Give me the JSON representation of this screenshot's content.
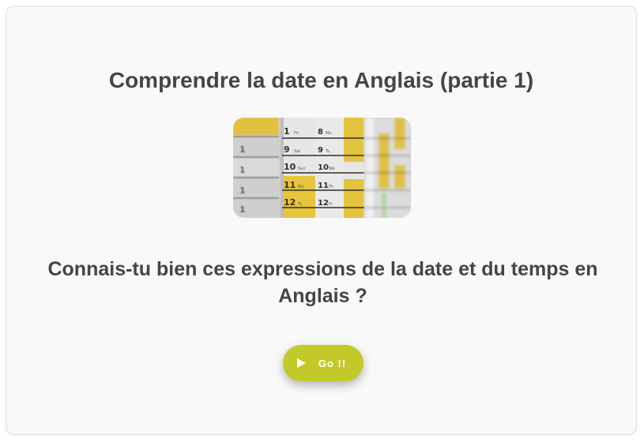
{
  "card": {
    "title": "Comprendre la date en Anglais (partie 1)",
    "image": {
      "icon": "calendar-photo",
      "colors": {
        "yellow": "#e7c43a",
        "paper": "#e2e2e2",
        "ink": "#2f2f2f"
      },
      "visible_numbers": [
        "8",
        "9",
        "10",
        "11",
        "12"
      ]
    },
    "question": "Connais-tu bien ces expressions de la date et du temps en Anglais ?",
    "button": {
      "label": "Go !!",
      "icon": "play-icon",
      "color": "#c4c92a"
    }
  }
}
